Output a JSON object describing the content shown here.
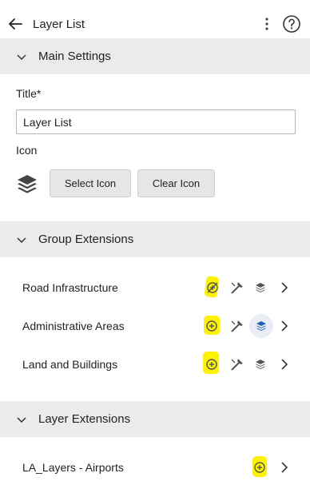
{
  "header": {
    "title": "Layer List"
  },
  "main_settings": {
    "section_label": "Main Settings",
    "title_label": "Title*",
    "title_value": "Layer List",
    "icon_label": "Icon",
    "select_icon_label": "Select Icon",
    "clear_icon_label": "Clear Icon"
  },
  "group_extensions": {
    "section_label": "Group Extensions",
    "items": [
      {
        "label": "Road Infrastructure",
        "icons": [
          "add-extension-icon",
          "tools-icon",
          "layers-stack-icon"
        ],
        "add_highlighted": true,
        "stack_active": false
      },
      {
        "label": "Administrative Areas",
        "icons": [
          "add-extension-icon",
          "tools-icon",
          "layers-stack-icon"
        ],
        "add_highlighted": true,
        "stack_active": true
      },
      {
        "label": "Land and Buildings",
        "icons": [
          "add-extension-icon",
          "tools-icon",
          "layers-stack-icon"
        ],
        "add_highlighted": true,
        "stack_active": false
      }
    ]
  },
  "layer_extensions": {
    "section_label": "Layer Extensions",
    "items": [
      {
        "label": "LA_Layers - Airports",
        "icons": [
          "add-extension-icon"
        ],
        "add_highlighted": true
      }
    ]
  },
  "colors": {
    "section_bg": "#ebebeb",
    "highlight": "#fff200",
    "active_icon": "#1f64b4",
    "icon_gray": "#555555"
  }
}
